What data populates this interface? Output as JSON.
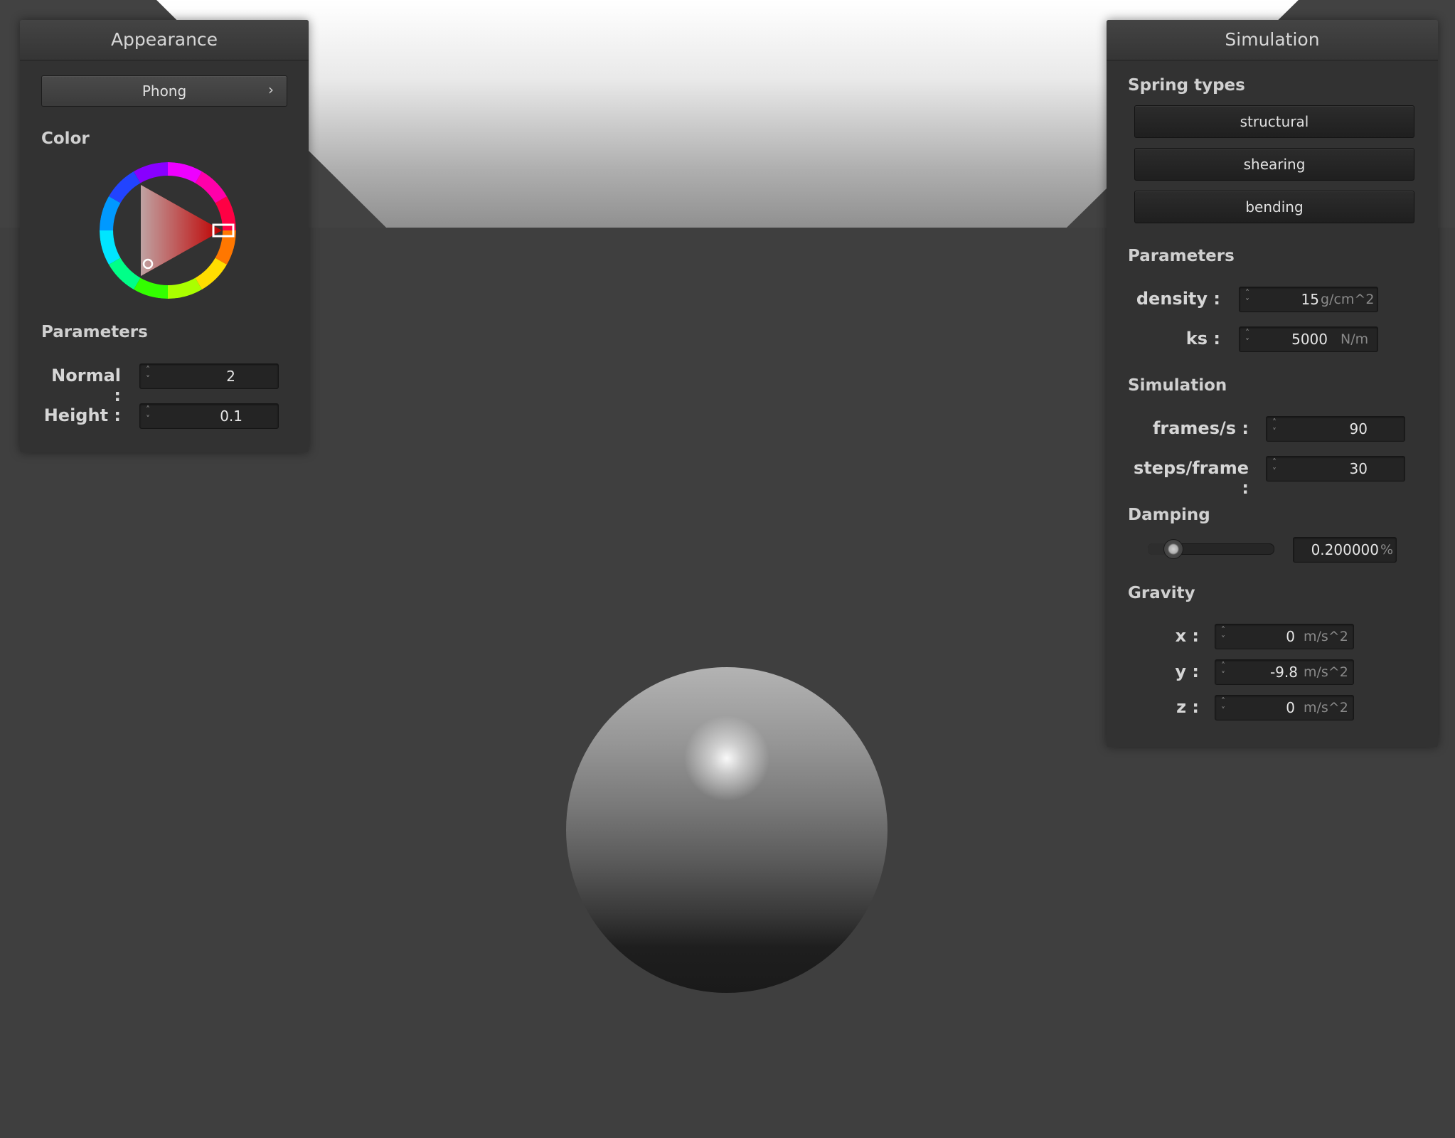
{
  "appearance_panel": {
    "title": "Appearance",
    "shader_button": "Phong",
    "shader_chevron": "›",
    "color_section": "Color",
    "selected_color": "#ff0000",
    "parameters_section": "Parameters",
    "normal_label": "Normal :",
    "normal_value": "2",
    "height_label": "Height :",
    "height_value": "0.1"
  },
  "simulation_panel": {
    "title": "Simulation",
    "spring_types_section": "Spring types",
    "spring_buttons": [
      "structural",
      "shearing",
      "bending"
    ],
    "parameters_section": "Parameters",
    "density_label": "density :",
    "density_value": "15",
    "density_unit": "g/cm^2",
    "ks_label": "ks :",
    "ks_value": "5000",
    "ks_unit": "N/m",
    "simulation_section": "Simulation",
    "fps_label": "frames/s :",
    "fps_value": "90",
    "steps_label": "steps/frame :",
    "steps_value": "30",
    "damping_section": "Damping",
    "damping_slider_level": 0.2,
    "damping_value": "0.200000",
    "damping_unit": "%",
    "gravity_section": "Gravity",
    "gravity": {
      "x_label": "x :",
      "x_value": "0",
      "y_label": "y :",
      "y_value": "-9.8",
      "z_label": "z :",
      "z_value": "0",
      "unit": "m/s^2"
    }
  },
  "icons": {
    "spin_up": "˄",
    "spin_down": "˅"
  }
}
